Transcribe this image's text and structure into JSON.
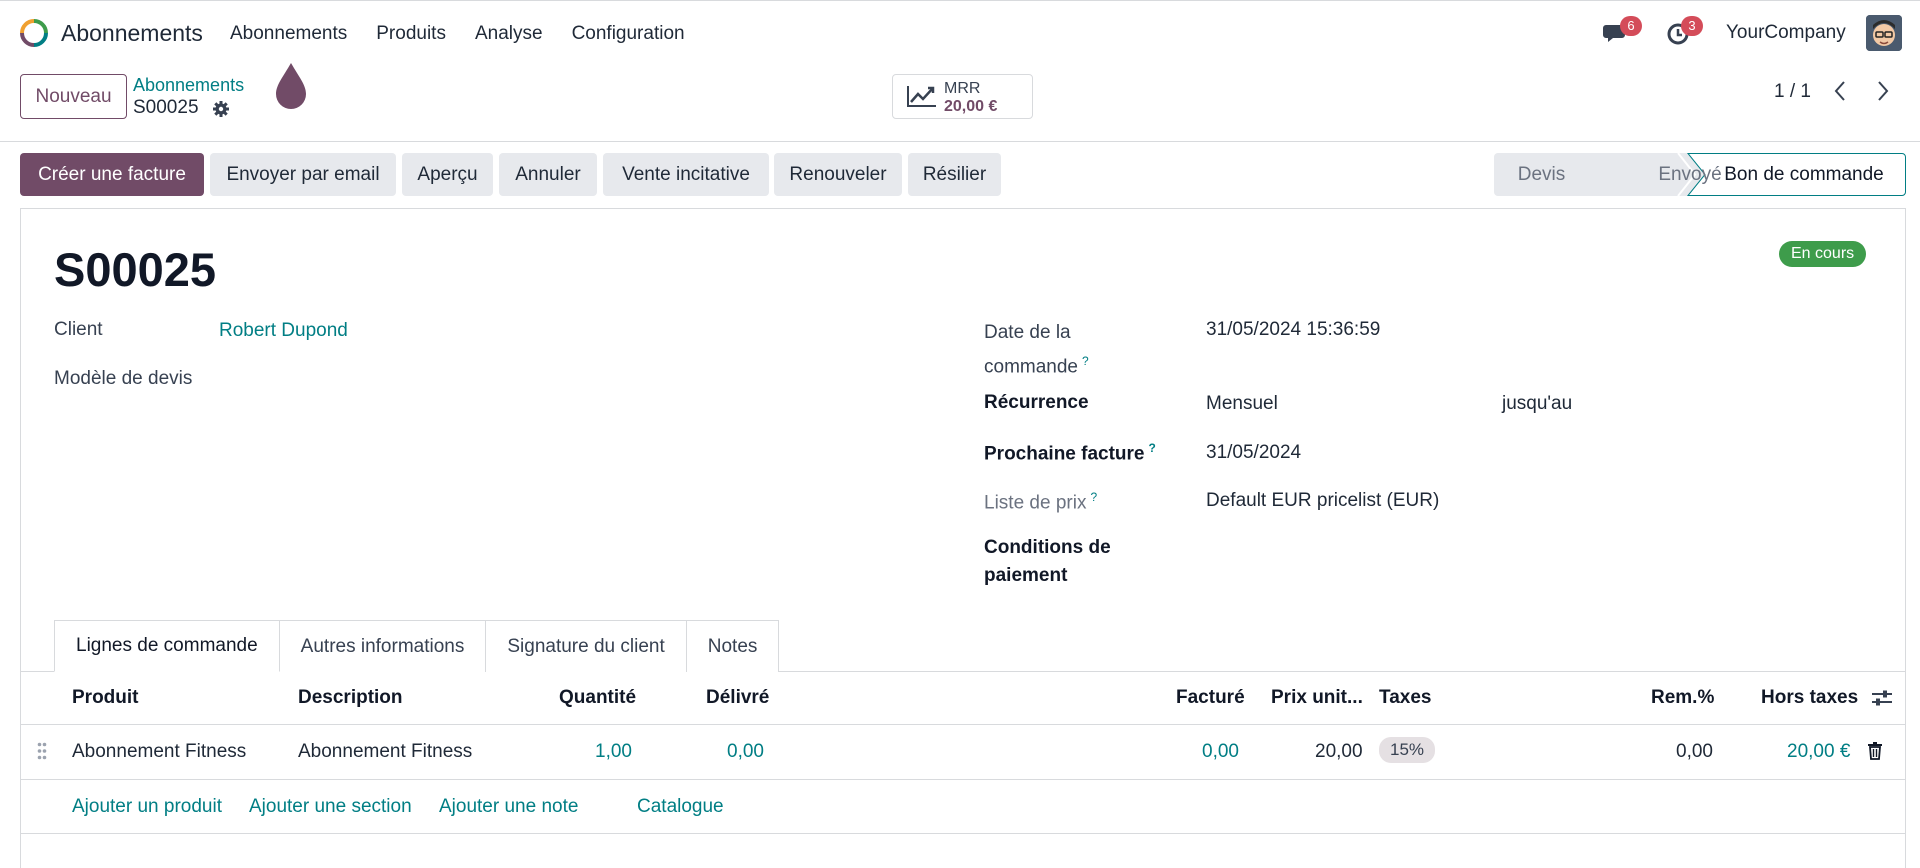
{
  "navbar": {
    "app_name": "Abonnements",
    "menu": [
      "Abonnements",
      "Produits",
      "Analyse",
      "Configuration"
    ],
    "chat_count": "6",
    "activity_count": "3",
    "company": "YourCompany"
  },
  "control_panel": {
    "new_label": "Nouveau",
    "breadcrumb_parent": "Abonnements",
    "breadcrumb_current": "S00025",
    "mrr_label": "MRR",
    "mrr_value": "20,00 €",
    "pager": "1 / 1"
  },
  "actions": [
    "Créer une facture",
    "Envoyer par email",
    "Aperçu",
    "Annuler",
    "Vente incitative",
    "Renouveler",
    "Résilier"
  ],
  "status_steps": [
    "Devis",
    "Envoyé",
    "Bon de commande"
  ],
  "colors": {
    "primary": "#714b67",
    "link": "#017e84",
    "success": "#3e9c4b",
    "badge": "#d44c59"
  },
  "form": {
    "title": "S00025",
    "state": "En cours",
    "client_label": "Client",
    "client_value": "Robert Dupond",
    "template_label": "Modèle de devis",
    "order_date_label_1": "Date de la",
    "order_date_label_2": "commande",
    "order_date_value": "31/05/2024 15:36:59",
    "recurrence_label": "Récurrence",
    "recurrence_value": "Mensuel",
    "until_label": "jusqu'au",
    "next_invoice_label": "Prochaine facture",
    "next_invoice_value": "31/05/2024",
    "pricelist_label": "Liste de prix",
    "pricelist_value": "Default EUR pricelist (EUR)",
    "payment_terms_label_1": "Conditions de",
    "payment_terms_label_2": "paiement",
    "help_mark": "?"
  },
  "tabs": [
    "Lignes de commande",
    "Autres informations",
    "Signature du client",
    "Notes"
  ],
  "order_lines": {
    "headers": [
      "Produit",
      "Description",
      "Quantité",
      "Délivré",
      "Facturé",
      "Prix unit...",
      "Taxes",
      "Rem.%",
      "Hors taxes"
    ],
    "rows": [
      {
        "product": "Abonnement Fitness",
        "description": "Abonnement Fitness",
        "quantity": "1,00",
        "delivered": "0,00",
        "invoiced": "0,00",
        "unit_price": "20,00",
        "taxes": "15%",
        "discount": "0,00",
        "subtotal": "20,00 €"
      }
    ],
    "add_links": [
      "Ajouter un produit",
      "Ajouter une section",
      "Ajouter une note",
      "Catalogue"
    ]
  }
}
